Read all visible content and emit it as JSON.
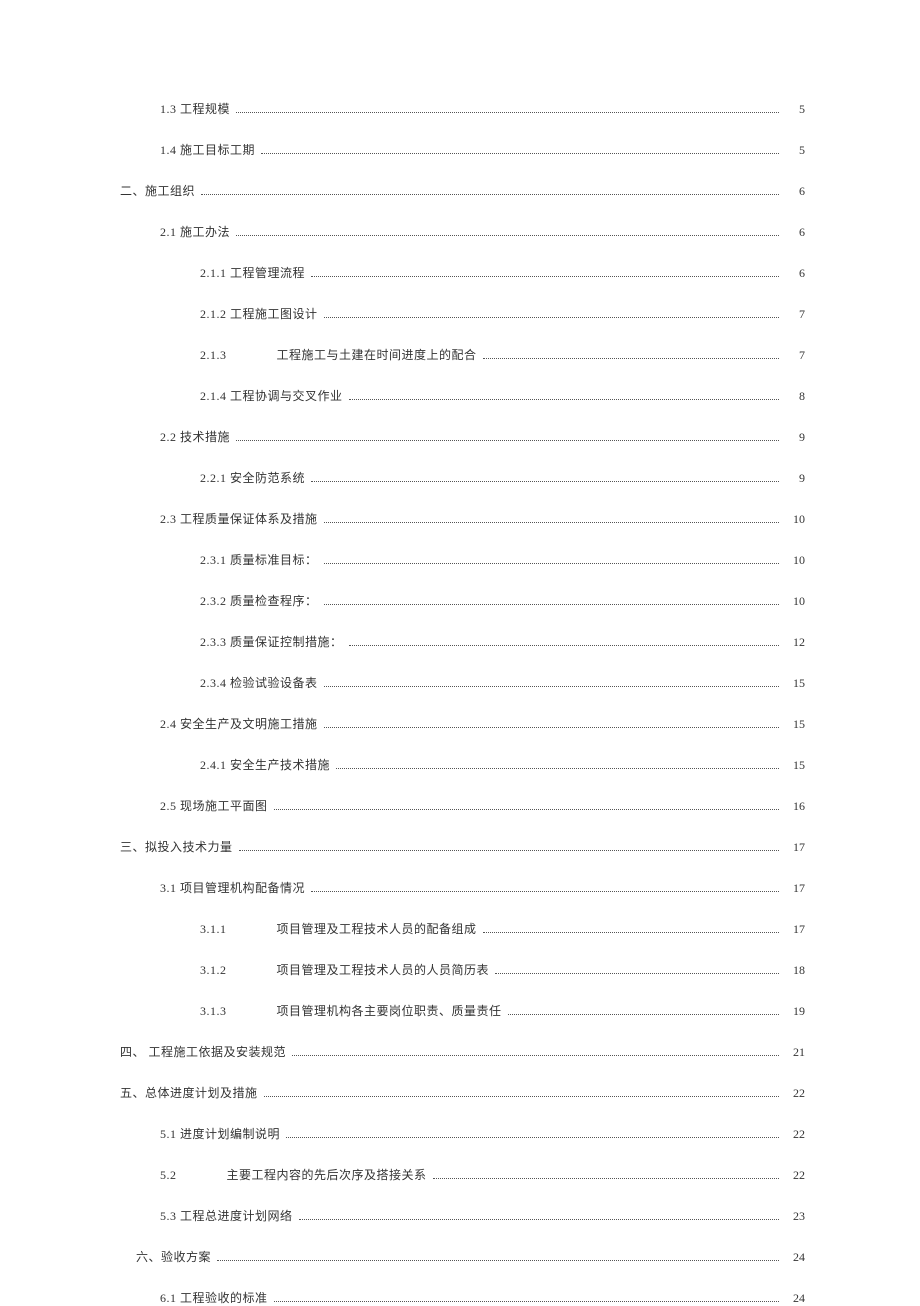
{
  "toc": [
    {
      "level": 1,
      "text": "1.3 工程规模",
      "page": "5"
    },
    {
      "level": 1,
      "text": "1.4 施工目标工期",
      "page": "5"
    },
    {
      "level": 0,
      "text": "二、施工组织",
      "page": "6"
    },
    {
      "level": 1,
      "text": "2.1 施工办法",
      "page": "6"
    },
    {
      "level": 2,
      "text": "2.1.1 工程管理流程",
      "page": "6"
    },
    {
      "level": 2,
      "text": "2.1.2  工程施工图设计",
      "page": "7"
    },
    {
      "level": 2,
      "split": true,
      "num": "2.1.3",
      "title": "工程施工与土建在时间进度上的配合",
      "page": "7"
    },
    {
      "level": 2,
      "text": "2.1.4 工程协调与交叉作业",
      "page": "8"
    },
    {
      "level": 1,
      "text": "2.2 技术措施",
      "page": "9"
    },
    {
      "level": 2,
      "text": "2.2.1  安全防范系统",
      "page": "9"
    },
    {
      "level": 1,
      "text": "2.3 工程质量保证体系及措施",
      "page": "10"
    },
    {
      "level": 2,
      "text": "2.3.1  质量标准目标：",
      "page": "10"
    },
    {
      "level": 2,
      "text": "2.3.2  质量检查程序：",
      "page": "10"
    },
    {
      "level": 2,
      "text": "2.3.3  质量保证控制措施：",
      "page": "12"
    },
    {
      "level": 2,
      "text": "2.3.4 检验试验设备表",
      "page": "15"
    },
    {
      "level": 1,
      "text": "2.4 安全生产及文明施工措施",
      "page": "15"
    },
    {
      "level": 2,
      "text": "2.4.1  安全生产技术措施",
      "page": "15"
    },
    {
      "level": 1,
      "text": "2.5 现场施工平面图",
      "page": "16"
    },
    {
      "level": 0,
      "text": "三、拟投入技术力量",
      "page": "17"
    },
    {
      "level": 1,
      "text": "3.1 项目管理机构配备情况",
      "page": "17"
    },
    {
      "level": 2,
      "split": true,
      "num": "3.1.1",
      "title": "项目管理及工程技术人员的配备组成",
      "page": "17"
    },
    {
      "level": 2,
      "split": true,
      "num": "3.1.2",
      "title": "项目管理及工程技术人员的人员简历表",
      "page": "18"
    },
    {
      "level": 2,
      "split": true,
      "num": "3.1.3",
      "title": "项目管理机构各主要岗位职责、质量责任",
      "page": "19"
    },
    {
      "level": 0,
      "text": "四、  工程施工依据及安装规范",
      "page": "21"
    },
    {
      "level": 0,
      "text": "五、总体进度计划及措施",
      "page": "22"
    },
    {
      "level": 1,
      "text": "5.1 进度计划编制说明",
      "page": "22"
    },
    {
      "level": 1,
      "split": true,
      "num": "5.2",
      "title": "主要工程内容的先后次序及搭接关系",
      "page": "22"
    },
    {
      "level": 1,
      "text": "5.3 工程总进度计划网络",
      "page": "23"
    },
    {
      "level": 0,
      "text": "六、验收方案",
      "page": "24",
      "indent_extra": true
    },
    {
      "level": 1,
      "text": "6.1 工程验收的标准",
      "page": "24"
    }
  ]
}
